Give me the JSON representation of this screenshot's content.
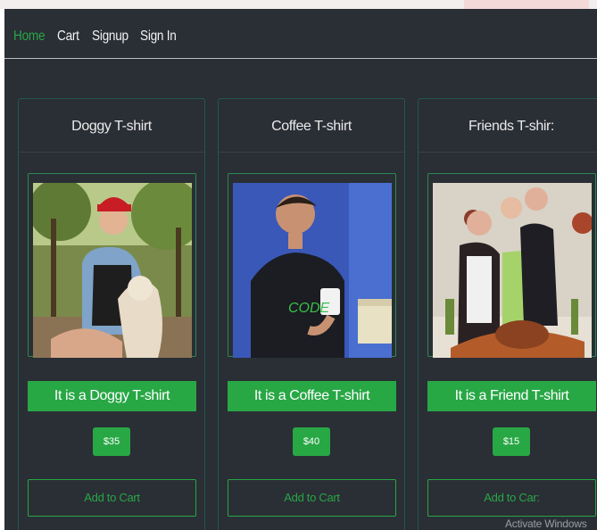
{
  "nav": {
    "links": [
      {
        "label": "Home",
        "active": true
      },
      {
        "label": "Cart",
        "active": false
      },
      {
        "label": "Signup",
        "active": false
      },
      {
        "label": "Sign In",
        "active": false
      }
    ]
  },
  "products": [
    {
      "title": "Doggy T-shirt",
      "description": "It is a Doggy T-shirt",
      "price": "$35",
      "button": "Add to Cart"
    },
    {
      "title": "Coffee T-shirt",
      "description": "It is a Coffee T-shirt",
      "price": "$40",
      "button": "Add to Cart"
    },
    {
      "title": "Friends T-shir:",
      "description": "It is a Friend T-shirt",
      "price": "$15",
      "button": "Add to Car:"
    }
  ],
  "watermark": "Activate Windows",
  "colors": {
    "accent": "#28a745",
    "background": "#2a2e35",
    "card_border": "#215a4b"
  }
}
